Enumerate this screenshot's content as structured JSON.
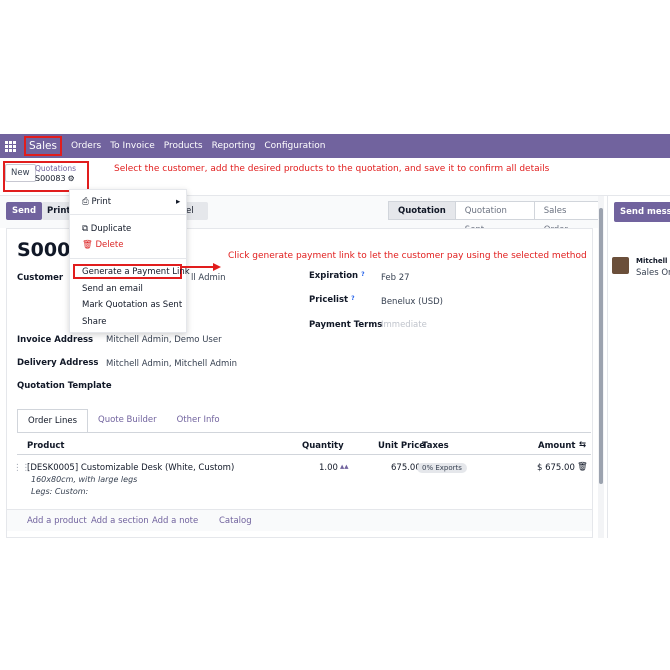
{
  "navbar": {
    "brand": "Sales",
    "items": [
      "Orders",
      "To Invoice",
      "Products",
      "Reporting",
      "Configuration"
    ]
  },
  "control": {
    "new_label": "New",
    "breadcrumb_parent": "Quotations",
    "breadcrumb_current": "S00083"
  },
  "annotations": {
    "top": "Select the customer, add the desired products to the quotation, and save it to confirm all details",
    "middle": "Click generate payment link to let the customer pay using the selected method"
  },
  "actions": {
    "send": "Send",
    "print": "Print",
    "cancel_fragment": "ncel"
  },
  "stages": [
    "Quotation",
    "Quotation Sent",
    "Sales Order"
  ],
  "active_stage": "Quotation",
  "menu": {
    "print": "Print",
    "duplicate": "Duplicate",
    "delete": "Delete",
    "generate_link": "Generate a Payment Link",
    "send_email": "Send an email",
    "mark_sent": "Mark Quotation as Sent",
    "share": "Share"
  },
  "form": {
    "title": "S00083",
    "customer_label": "Customer",
    "customer_fragment": "ll Admin",
    "invoice_label": "Invoice Address",
    "invoice_value": "Mitchell Admin, Demo User",
    "delivery_label": "Delivery Address",
    "delivery_value": "Mitchell Admin, Mitchell Admin",
    "template_label": "Quotation Template",
    "expiration_label": "Expiration",
    "expiration_value": "Feb 27",
    "pricelist_label": "Pricelist",
    "pricelist_value": "Benelux (USD)",
    "payment_terms_label": "Payment Terms",
    "payment_terms_placeholder": "Immediate",
    "help_mark": "?"
  },
  "tabs": [
    "Order Lines",
    "Quote Builder",
    "Other Info"
  ],
  "table": {
    "headers": {
      "product": "Product",
      "quantity": "Quantity",
      "unit_price": "Unit Price",
      "taxes": "Taxes",
      "amount": "Amount"
    },
    "row": {
      "product": "[DESK0005] Customizable Desk (White, Custom)",
      "desc1": "160x80cm, with large legs",
      "desc2": "Legs: Custom:",
      "quantity": "1.00",
      "unit_price": "675.00",
      "tax": "0% Exports",
      "amount": "$ 675.00"
    },
    "add_links": [
      "Add a product",
      "Add a section",
      "Add a note",
      "Catalog"
    ]
  },
  "chatter": {
    "send_message": "Send messag",
    "author": "Mitchell A",
    "text": "Sales Ord"
  },
  "colors": {
    "brand": "#71639e",
    "annotation": "#e11d1d",
    "danger": "#dc2626"
  },
  "icons": [
    "apps-grid-icon",
    "gear-icon",
    "printer-icon",
    "caret-right-icon",
    "copy-icon",
    "trash-icon",
    "drag-handle-icon",
    "forecast-chart-icon",
    "options-toggle-icon"
  ]
}
